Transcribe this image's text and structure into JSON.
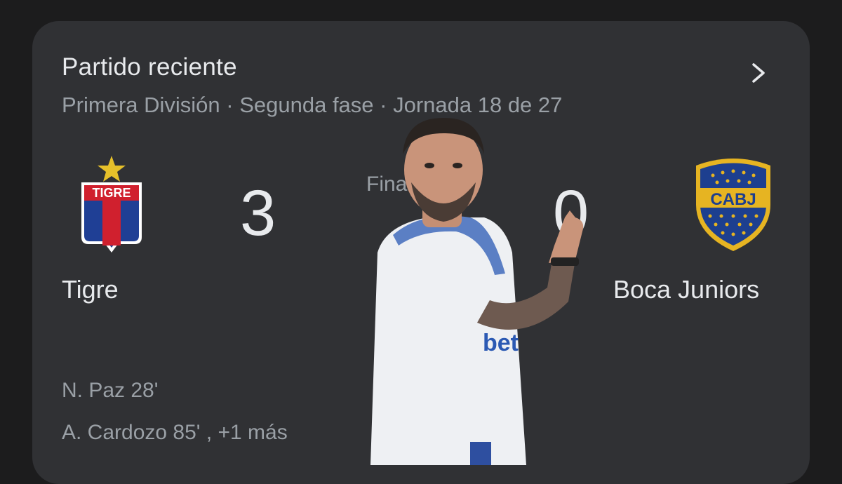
{
  "card": {
    "title": "Partido reciente",
    "subtitle": "Primera División · Segunda fase · Jornada 18 de 27",
    "chevron_icon": "chevron-right-icon"
  },
  "match": {
    "home": {
      "name": "Tigre",
      "score": "3",
      "crest_text": "TIGRE",
      "crest_icon": "tigre-crest-icon"
    },
    "away": {
      "name": "Boca Juniors",
      "score": "0",
      "crest_text": "CABJ",
      "crest_icon": "boca-juniors-crest-icon"
    },
    "status": "Fina"
  },
  "scorers": {
    "home": [
      "N. Paz 28'",
      "A. Cardozo 85' , +1 más"
    ]
  },
  "colors": {
    "background": "#1c1c1d",
    "card": "#303134",
    "primary_text": "#e8eaed",
    "secondary_text": "#9aa0a6",
    "tigre_blue": "#1f3f95",
    "tigre_red": "#d0202e",
    "boca_blue": "#1d3f8f",
    "boca_gold": "#e6b422"
  }
}
